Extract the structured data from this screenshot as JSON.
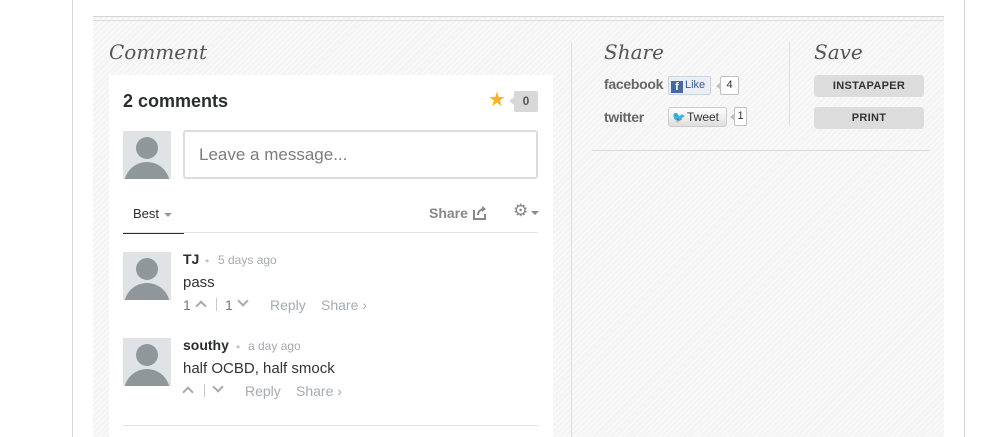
{
  "sections": {
    "comment_heading": "Comment",
    "share_heading": "Share",
    "save_heading": "Save"
  },
  "comments": {
    "count_label": "2 comments",
    "star_count": "0",
    "input_placeholder": "Leave a message...",
    "sort_tab": "Best",
    "share_label": "Share",
    "items": [
      {
        "author": "TJ",
        "time": "5 days ago",
        "text": "pass",
        "upvotes": "1",
        "downvotes": "1",
        "reply": "Reply",
        "share": "Share ›"
      },
      {
        "author": "southy",
        "time": "a day ago",
        "text": "half OCBD, half smock",
        "upvotes": "",
        "downvotes": "",
        "reply": "Reply",
        "share": "Share ›"
      }
    ]
  },
  "share": {
    "facebook_label": "facebook",
    "like_label": "Like",
    "like_count": "4",
    "twitter_label": "twitter",
    "tweet_label": "Tweet",
    "tweet_count": "1"
  },
  "save": {
    "instapaper_label": "INSTAPAPER",
    "print_label": "PRINT"
  },
  "colors": {
    "star": "#f3b61f",
    "facebook": "#3b5998",
    "twitter_bird": "#2ea1f0",
    "avatar": "#8f979b"
  },
  "icons": {
    "star": "star-icon",
    "share": "share-export-icon",
    "settings": "gear-icon",
    "upvote": "chevron-up-icon",
    "downvote": "chevron-down-icon",
    "avatar": "default-avatar-icon"
  }
}
